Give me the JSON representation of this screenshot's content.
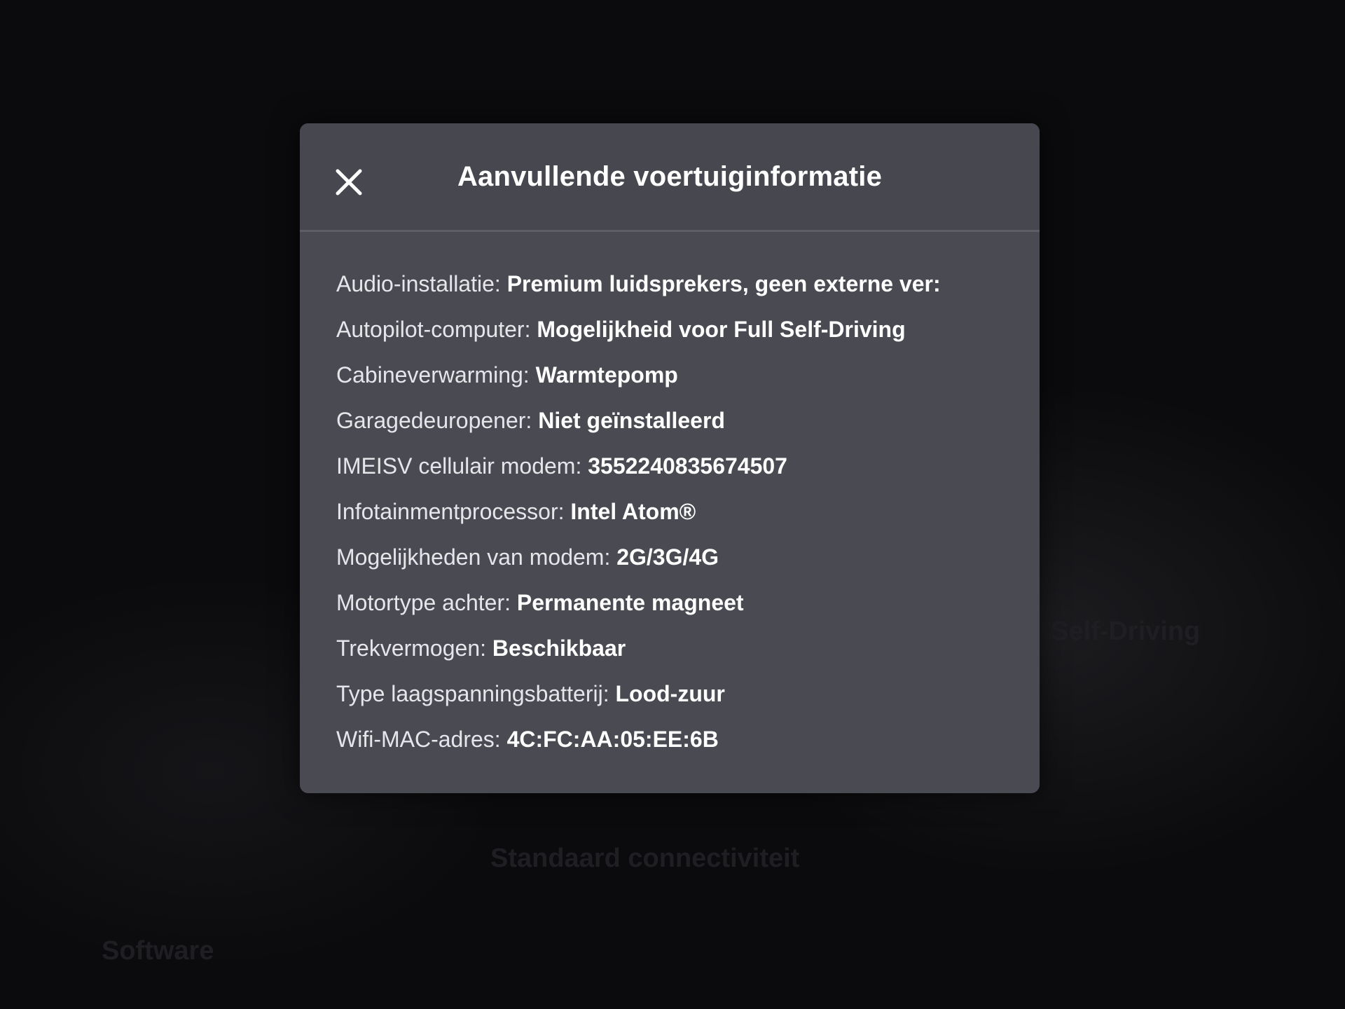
{
  "background": {
    "items": [
      "Standaard connectiviteit",
      "Software",
      "Self-Driving"
    ]
  },
  "dialog": {
    "title": "Aanvullende voertuiginformatie",
    "close_icon": "close-icon",
    "rows": [
      {
        "label": "Audio-installatie:",
        "value": "Premium luidsprekers, geen externe ver:"
      },
      {
        "label": "Autopilot-computer:",
        "value": "Mogelijkheid voor Full Self-Driving"
      },
      {
        "label": "Cabineverwarming:",
        "value": "Warmtepomp"
      },
      {
        "label": "Garagedeuropener:",
        "value": "Niet geïnstalleerd"
      },
      {
        "label": "IMEISV cellulair modem:",
        "value": "3552240835674507"
      },
      {
        "label": "Infotainmentprocessor:",
        "value": "Intel Atom®"
      },
      {
        "label": "Mogelijkheden van modem:",
        "value": "2G/3G/4G"
      },
      {
        "label": "Motortype achter:",
        "value": "Permanente magneet"
      },
      {
        "label": "Trekvermogen:",
        "value": "Beschikbaar"
      },
      {
        "label": "Type laagspanningsbatterij:",
        "value": "Lood-zuur"
      },
      {
        "label": "Wifi-MAC-adres:",
        "value": "4C:FC:AA:05:EE:6B"
      }
    ]
  },
  "colors": {
    "dialog_bg": "#4a4b52",
    "text": "#ffffff",
    "screen_bg": "#0b0b0d"
  }
}
